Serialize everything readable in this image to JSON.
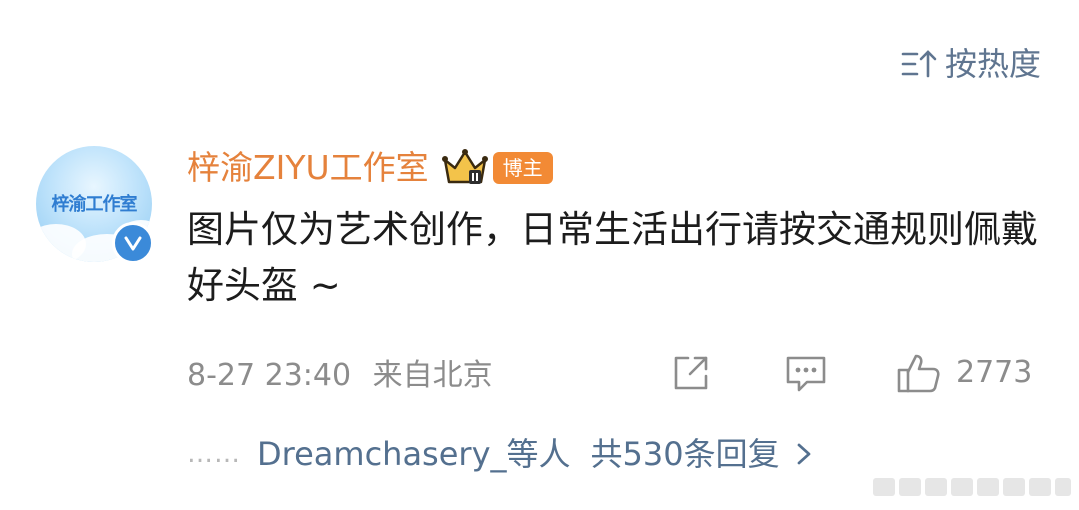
{
  "sort": {
    "label": "按热度"
  },
  "comment": {
    "username": "梓渝ZIYU工作室",
    "avatar_text": "梓渝工作室",
    "badge": "博主",
    "content": "图片仅为艺术创作，日常生活出行请按交通规则佩戴好头盔 ~",
    "date": "8-27 23:40",
    "location": "来自北京",
    "likes": "2773"
  },
  "replies": {
    "dots": "……",
    "users": "Dreamchasery_等人",
    "total": "共530条回复"
  },
  "colors": {
    "username": "#e5823c",
    "link": "#54708f",
    "meta": "#8c8c8c",
    "badge": "#f28a35"
  }
}
